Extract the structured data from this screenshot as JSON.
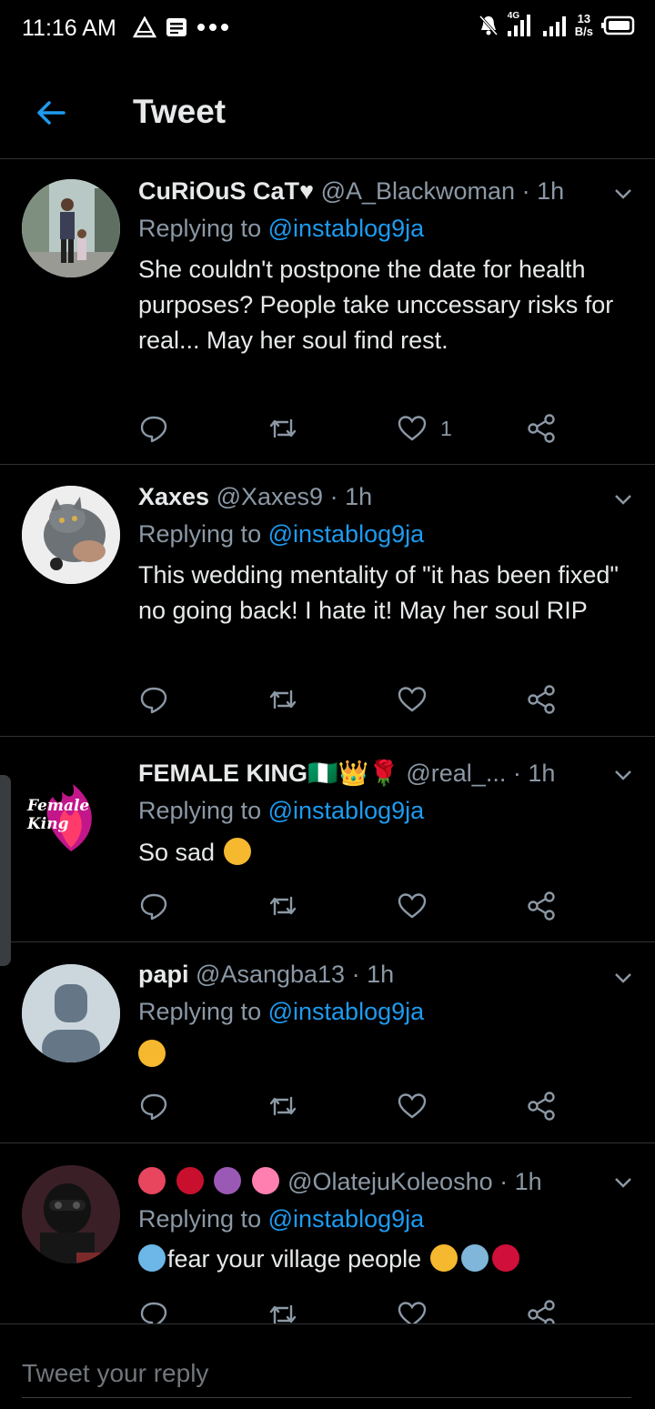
{
  "status_bar": {
    "time": "11:16 AM",
    "network_type": "4G",
    "net_speed_value": "13",
    "net_speed_unit": "B/s"
  },
  "app_bar": {
    "title": "Tweet"
  },
  "tweets": [
    {
      "name": "CuRiOuS CaT♥",
      "handle": "@A_Blackwoman",
      "time": "· 1h",
      "replying_prefix": "Replying to",
      "replying_to": "@instablog9ja",
      "text": "She couldn't postpone the date for health purposes? People take unccessary risks for real... May her soul find rest.",
      "likes": "1"
    },
    {
      "name": "Xaxes",
      "handle": "@Xaxes9",
      "time": "· 1h",
      "replying_prefix": "Replying to",
      "replying_to": "@instablog9ja",
      "text": "This wedding mentality of \"it has been fixed\" no going back! I hate it! May her soul RIP"
    },
    {
      "name": "FEMALE KING",
      "name_emoji": "🇳🇬👑🌹",
      "handle": "@real_...",
      "time": "· 1h",
      "avatar_text": "Female King",
      "replying_prefix": "Replying to",
      "replying_to": "@instablog9ja",
      "text": "So sad"
    },
    {
      "name": "papi",
      "handle": "@Asangba13",
      "time": "· 1h",
      "replying_prefix": "Replying to",
      "replying_to": "@instablog9ja",
      "text": ""
    },
    {
      "name": "",
      "handle": "@OlatejuKoleosho",
      "time": "· 1h",
      "replying_prefix": "Replying to",
      "replying_to": "@instablog9ja",
      "text": "fear your village people"
    }
  ],
  "compose": {
    "placeholder": "Tweet your reply"
  },
  "icons": {
    "back": "arrow-left-icon",
    "chevron": "chevron-down-icon",
    "reply": "reply-icon",
    "retweet": "retweet-icon",
    "like": "heart-icon",
    "share": "share-icon"
  },
  "colors": {
    "accent": "#1d9bf0",
    "background": "#000000",
    "secondary_text": "#8b98a5"
  }
}
